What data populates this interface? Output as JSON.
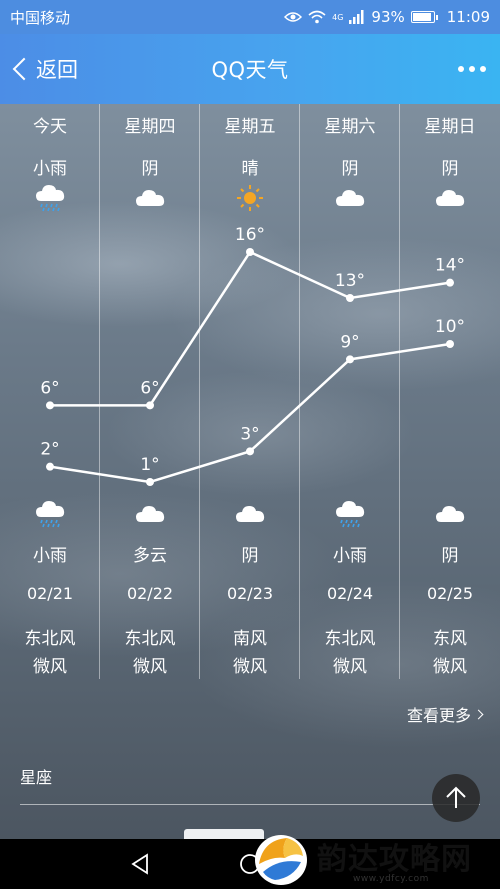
{
  "status_bar": {
    "carrier": "中国移动",
    "network": "4G",
    "battery_percent": "93%",
    "battery_level": 0.93,
    "time": "11:09"
  },
  "header": {
    "back_label": "返回",
    "title": "QQ天气",
    "more_icon": "more-dots-icon"
  },
  "forecast": [
    {
      "day": "今天",
      "cond_top": "小雨",
      "icon_top": "rain-cloud-icon",
      "high": "6°",
      "low": "2°",
      "icon_bottom": "rain-cloud-icon",
      "cond_bottom": "小雨",
      "date": "02/21",
      "wind_dir": "东北风",
      "wind_level": "微风"
    },
    {
      "day": "星期四",
      "cond_top": "阴",
      "icon_top": "cloud-icon",
      "high": "6°",
      "low": "1°",
      "icon_bottom": "cloud-icon",
      "cond_bottom": "多云",
      "date": "02/22",
      "wind_dir": "东北风",
      "wind_level": "微风"
    },
    {
      "day": "星期五",
      "cond_top": "晴",
      "icon_top": "sun-icon",
      "high": "16°",
      "low": "3°",
      "icon_bottom": "cloud-icon",
      "cond_bottom": "阴",
      "date": "02/23",
      "wind_dir": "南风",
      "wind_level": "微风"
    },
    {
      "day": "星期六",
      "cond_top": "阴",
      "icon_top": "cloud-icon",
      "high": "13°",
      "low": "9°",
      "icon_bottom": "rain-cloud-icon",
      "cond_bottom": "小雨",
      "date": "02/24",
      "wind_dir": "东北风",
      "wind_level": "微风"
    },
    {
      "day": "星期日",
      "cond_top": "阴",
      "icon_top": "cloud-icon",
      "high": "14°",
      "low": "10°",
      "icon_bottom": "cloud-icon",
      "cond_bottom": "阴",
      "date": "02/25",
      "wind_dir": "东风",
      "wind_level": "微风"
    }
  ],
  "chart_data": {
    "type": "line",
    "categories": [
      "今天",
      "星期四",
      "星期五",
      "星期六",
      "星期日"
    ],
    "series": [
      {
        "values": [
          6,
          6,
          16,
          13,
          14
        ]
      },
      {
        "values": [
          2,
          1,
          3,
          9,
          10
        ]
      }
    ],
    "ylim": [
      0,
      17
    ]
  },
  "links": {
    "more_label": "查看更多"
  },
  "sections": {
    "constellation_title": "星座"
  },
  "watermark": {
    "text": "韵达攻略网",
    "url": "www.ydfcy.com"
  }
}
